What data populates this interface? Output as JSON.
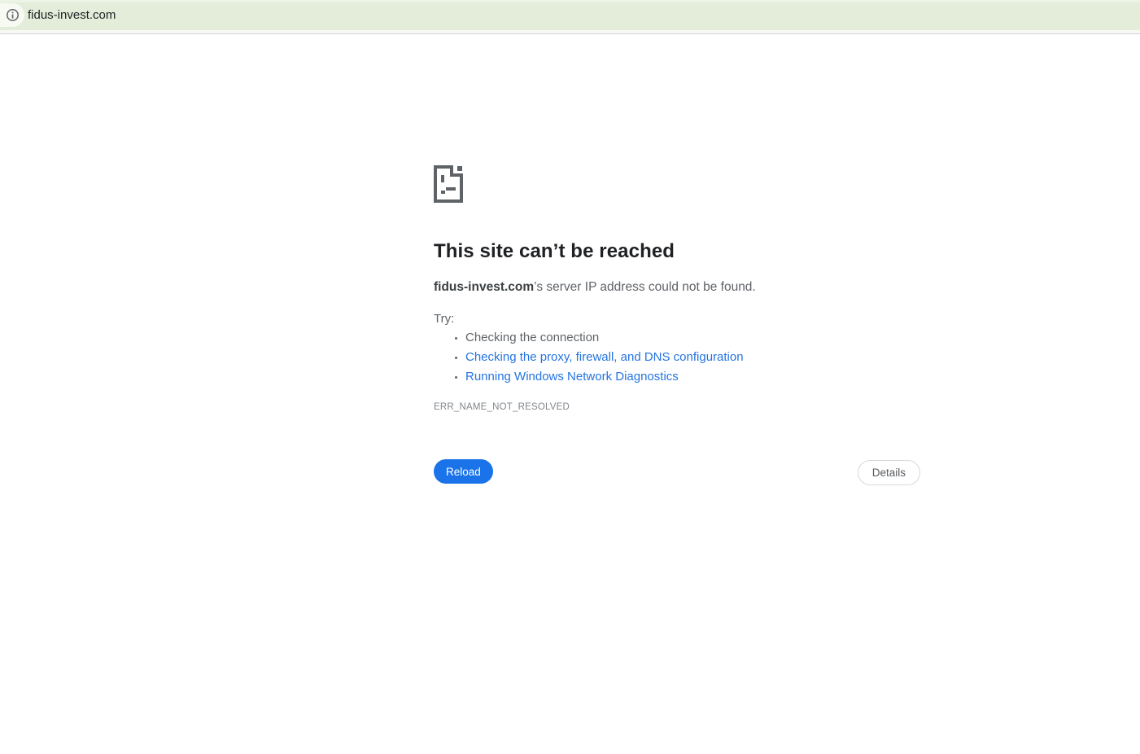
{
  "browser": {
    "url": "fidus-invest.com"
  },
  "error_page": {
    "title": "This site can’t be reached",
    "subtitle_domain": "fidus-invest.com",
    "subtitle_rest": "’s server IP address could not be found.",
    "try_label": "Try:",
    "suggestions": [
      {
        "label": "Checking the connection",
        "is_link": false
      },
      {
        "label": "Checking the proxy, firewall, and DNS configuration",
        "is_link": true
      },
      {
        "label": "Running Windows Network Diagnostics",
        "is_link": true
      }
    ],
    "error_code": "ERR_NAME_NOT_RESOLVED",
    "reload_label": "Reload",
    "details_label": "Details"
  },
  "colors": {
    "toolbar_background": "#e3edda",
    "link_blue": "#2474e0",
    "reload_button": "#1a73e8",
    "text_gray": "#5f6368",
    "heading": "#202124"
  }
}
